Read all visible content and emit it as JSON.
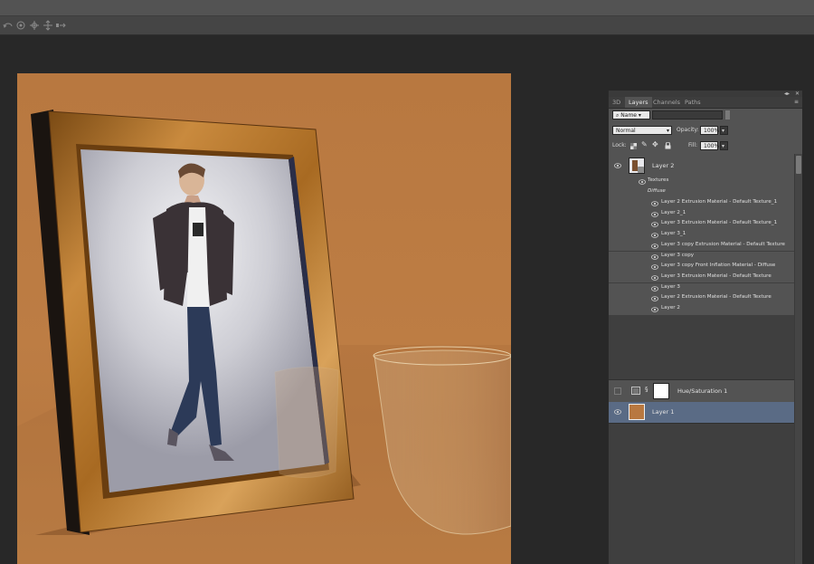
{
  "panel": {
    "tabs": [
      "3D",
      "Layers",
      "Channels",
      "Paths"
    ],
    "active_tab": "Layers",
    "filter": {
      "label": "Name"
    },
    "blend_mode": "Normal",
    "opacity": {
      "label": "Opacity:",
      "value": "100%"
    },
    "lock": {
      "label": "Lock:"
    },
    "fill": {
      "label": "Fill:",
      "value": "100%"
    },
    "layers": [
      {
        "name": "Layer 2",
        "visible": true,
        "type": "3d"
      },
      {
        "name": "Hue/Saturation 1",
        "visible": false,
        "type": "adjustment"
      },
      {
        "name": "Layer 1",
        "visible": true,
        "type": "pixel",
        "selected": true
      }
    ],
    "textures_label": "Textures",
    "diffuse_label": "Diffuse",
    "texture_items": [
      "Layer 2 Extrusion Material - Default Texture_1",
      "Layer 2_1",
      "Layer 3 Extrusion Material - Default Texture_1",
      "Layer 3_1",
      "Layer 3 copy Extrusion Material - Default Texture",
      "Layer 3 copy",
      "Layer 3 copy Front Inflation Material - Diffuse",
      "Layer 3 Extrusion Material - Default Texture",
      "Layer 3",
      "Layer 2 Extrusion Material - Default Texture",
      "Layer 2"
    ]
  },
  "colors": {
    "accent_selected": "#5a6b85",
    "canvas_orange": "#bd7d44",
    "frame_gold": "#b8782e"
  },
  "icons": [
    "eye-icon",
    "chain-link-icon",
    "search-icon",
    "lock-icon",
    "brush-icon",
    "move-icon",
    "checkerboard-icon"
  ]
}
